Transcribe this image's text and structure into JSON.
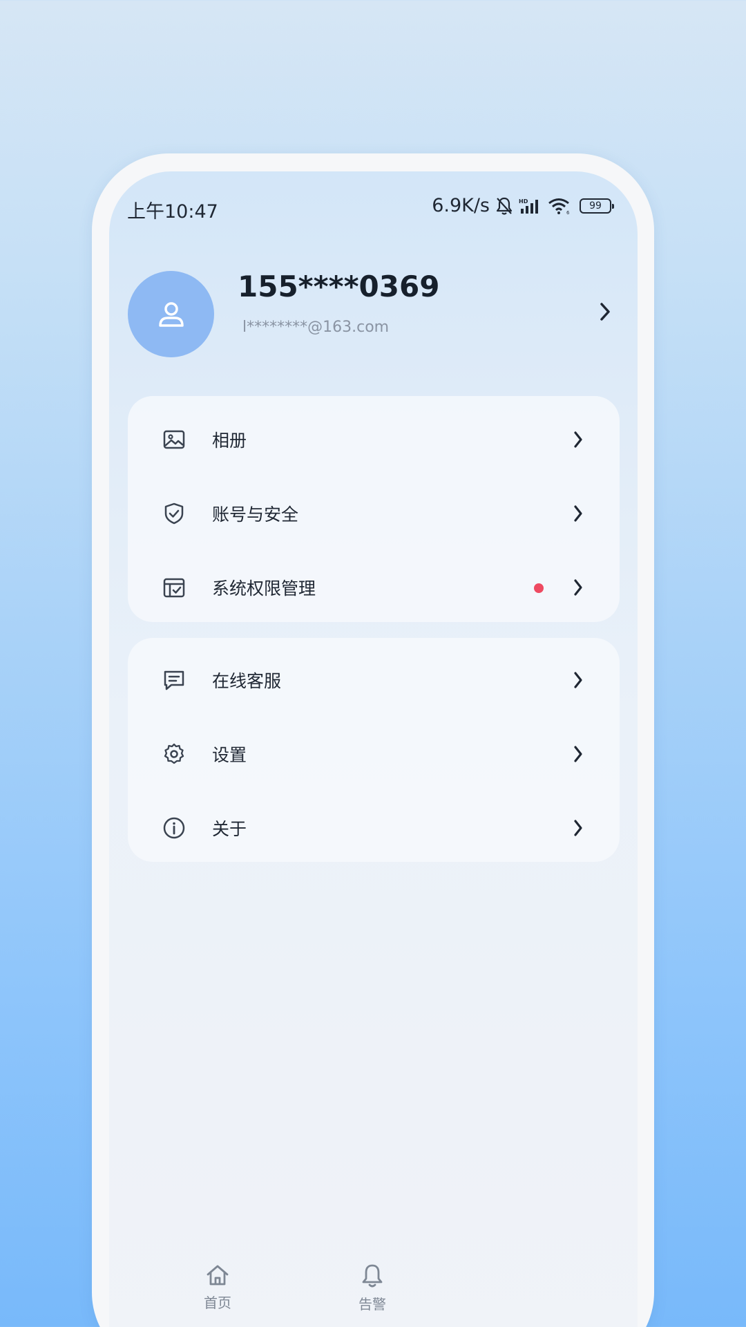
{
  "status": {
    "time": "上午10:47",
    "speed": "6.9K/s",
    "battery": "99"
  },
  "profile": {
    "phone": "155****0369",
    "email": "l********@163.com"
  },
  "menu_group1": [
    {
      "label": "相册",
      "icon": "image-icon"
    },
    {
      "label": "账号与安全",
      "icon": "shield-check-icon"
    },
    {
      "label": "系统权限管理",
      "icon": "permission-icon",
      "badge": true
    }
  ],
  "menu_group2": [
    {
      "label": "在线客服",
      "icon": "chat-icon"
    },
    {
      "label": "设置",
      "icon": "gear-icon"
    },
    {
      "label": "关于",
      "icon": "info-icon"
    }
  ],
  "tabbar": {
    "items": [
      {
        "label": "首页",
        "icon": "home-icon"
      },
      {
        "label": "告警",
        "icon": "bell-icon"
      }
    ]
  },
  "colors": {
    "accent": "#8eb9f3",
    "badge": "#ee4a61"
  }
}
